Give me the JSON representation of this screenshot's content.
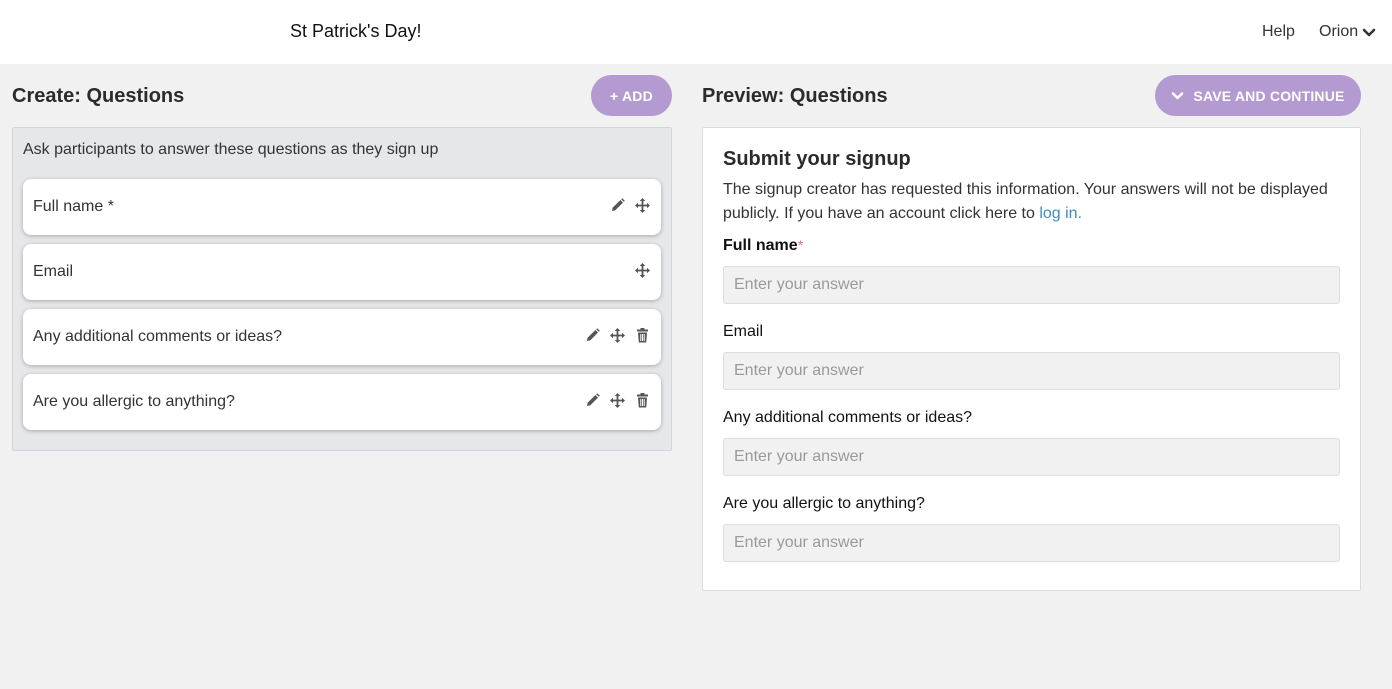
{
  "header": {
    "event_title": "St Patrick's Day!",
    "help_label": "Help",
    "user_name": "Orion"
  },
  "create": {
    "title": "Create: Questions",
    "add_label": "+ ADD",
    "intro": "Ask participants to answer these questions as they sign up",
    "questions": [
      {
        "label": "Full name *",
        "icons": [
          "pencil-icon",
          "move-icon"
        ]
      },
      {
        "label": "Email",
        "icons": [
          "move-icon"
        ]
      },
      {
        "label": "Any additional comments or ideas?",
        "icons": [
          "pencil-icon",
          "move-icon",
          "trash-icon"
        ]
      },
      {
        "label": "Are you allergic to anything?",
        "icons": [
          "pencil-icon",
          "move-icon",
          "trash-icon"
        ]
      }
    ]
  },
  "preview": {
    "title": "Preview: Questions",
    "save_label": "SAVE AND CONTINUE",
    "form_title": "Submit your signup",
    "description": "The signup creator has requested this information. Your answers will not be displayed publicly. If you have an account click here to",
    "login_link": "log in.",
    "fields": [
      {
        "label": "Full name",
        "required_mark": "*",
        "placeholder": "Enter your answer"
      },
      {
        "label": "Email",
        "placeholder": "Enter your answer"
      },
      {
        "label": "Any additional comments or ideas?",
        "placeholder": "Enter your answer"
      },
      {
        "label": "Are you allergic to anything?",
        "placeholder": "Enter your answer"
      }
    ]
  },
  "colors": {
    "accent": "#b39ad0",
    "link": "#3d8cc4",
    "background": "#f0f1f0"
  }
}
